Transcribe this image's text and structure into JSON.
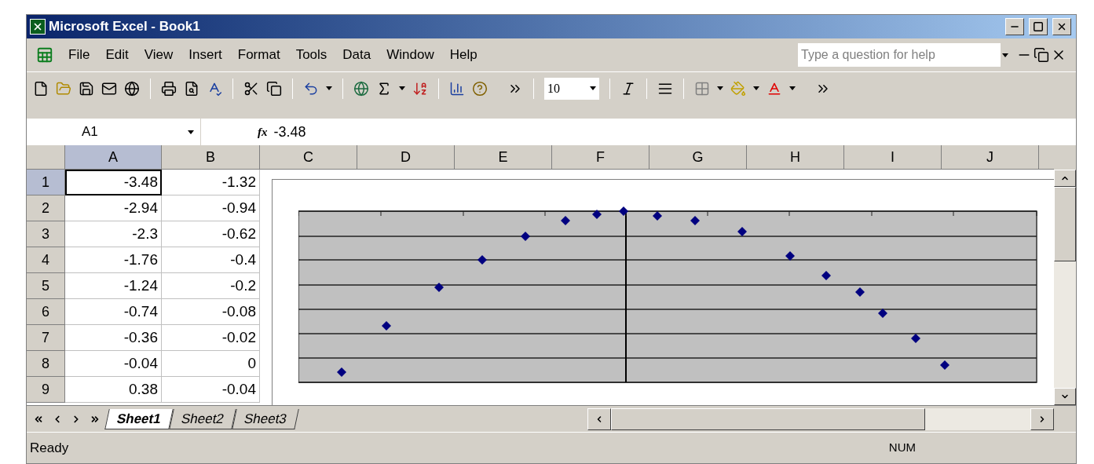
{
  "window": {
    "title": "Microsoft Excel - Book1"
  },
  "menu": [
    "File",
    "Edit",
    "View",
    "Insert",
    "Format",
    "Tools",
    "Data",
    "Window",
    "Help"
  ],
  "help_box": {
    "placeholder": "Type a question for help"
  },
  "toolbar": {
    "font_size": "10"
  },
  "formula_bar": {
    "name_box": "A1",
    "function_label": "fx",
    "value": "-3.48"
  },
  "columns": [
    {
      "label": "A",
      "selected": true
    },
    {
      "label": "B",
      "selected": false
    },
    {
      "label": "C",
      "selected": false
    },
    {
      "label": "D",
      "selected": false
    },
    {
      "label": "E",
      "selected": false
    },
    {
      "label": "F",
      "selected": false
    },
    {
      "label": "G",
      "selected": false
    },
    {
      "label": "H",
      "selected": false
    },
    {
      "label": "I",
      "selected": false
    },
    {
      "label": "J",
      "selected": false
    }
  ],
  "rows": [
    {
      "number": "1",
      "a": "-3.48",
      "b": "-1.32",
      "selected": true
    },
    {
      "number": "2",
      "a": "-2.94",
      "b": "-0.94",
      "selected": false
    },
    {
      "number": "3",
      "a": "-2.3",
      "b": "-0.62",
      "selected": false
    },
    {
      "number": "4",
      "a": "-1.76",
      "b": "-0.4",
      "selected": false
    },
    {
      "number": "5",
      "a": "-1.24",
      "b": "-0.2",
      "selected": false
    },
    {
      "number": "6",
      "a": "-0.74",
      "b": "-0.08",
      "selected": false
    },
    {
      "number": "7",
      "a": "-0.36",
      "b": "-0.02",
      "selected": false
    },
    {
      "number": "8",
      "a": "-0.04",
      "b": "0",
      "selected": false
    },
    {
      "number": "9",
      "a": "0.38",
      "b": "-0.04",
      "selected": false
    }
  ],
  "sheet_tabs": [
    {
      "label": "Sheet1",
      "selected": true
    },
    {
      "label": "Sheet2",
      "selected": false
    },
    {
      "label": "Sheet3",
      "selected": false
    }
  ],
  "status_bar": {
    "status": "Ready",
    "num_lock": "NUM"
  }
}
